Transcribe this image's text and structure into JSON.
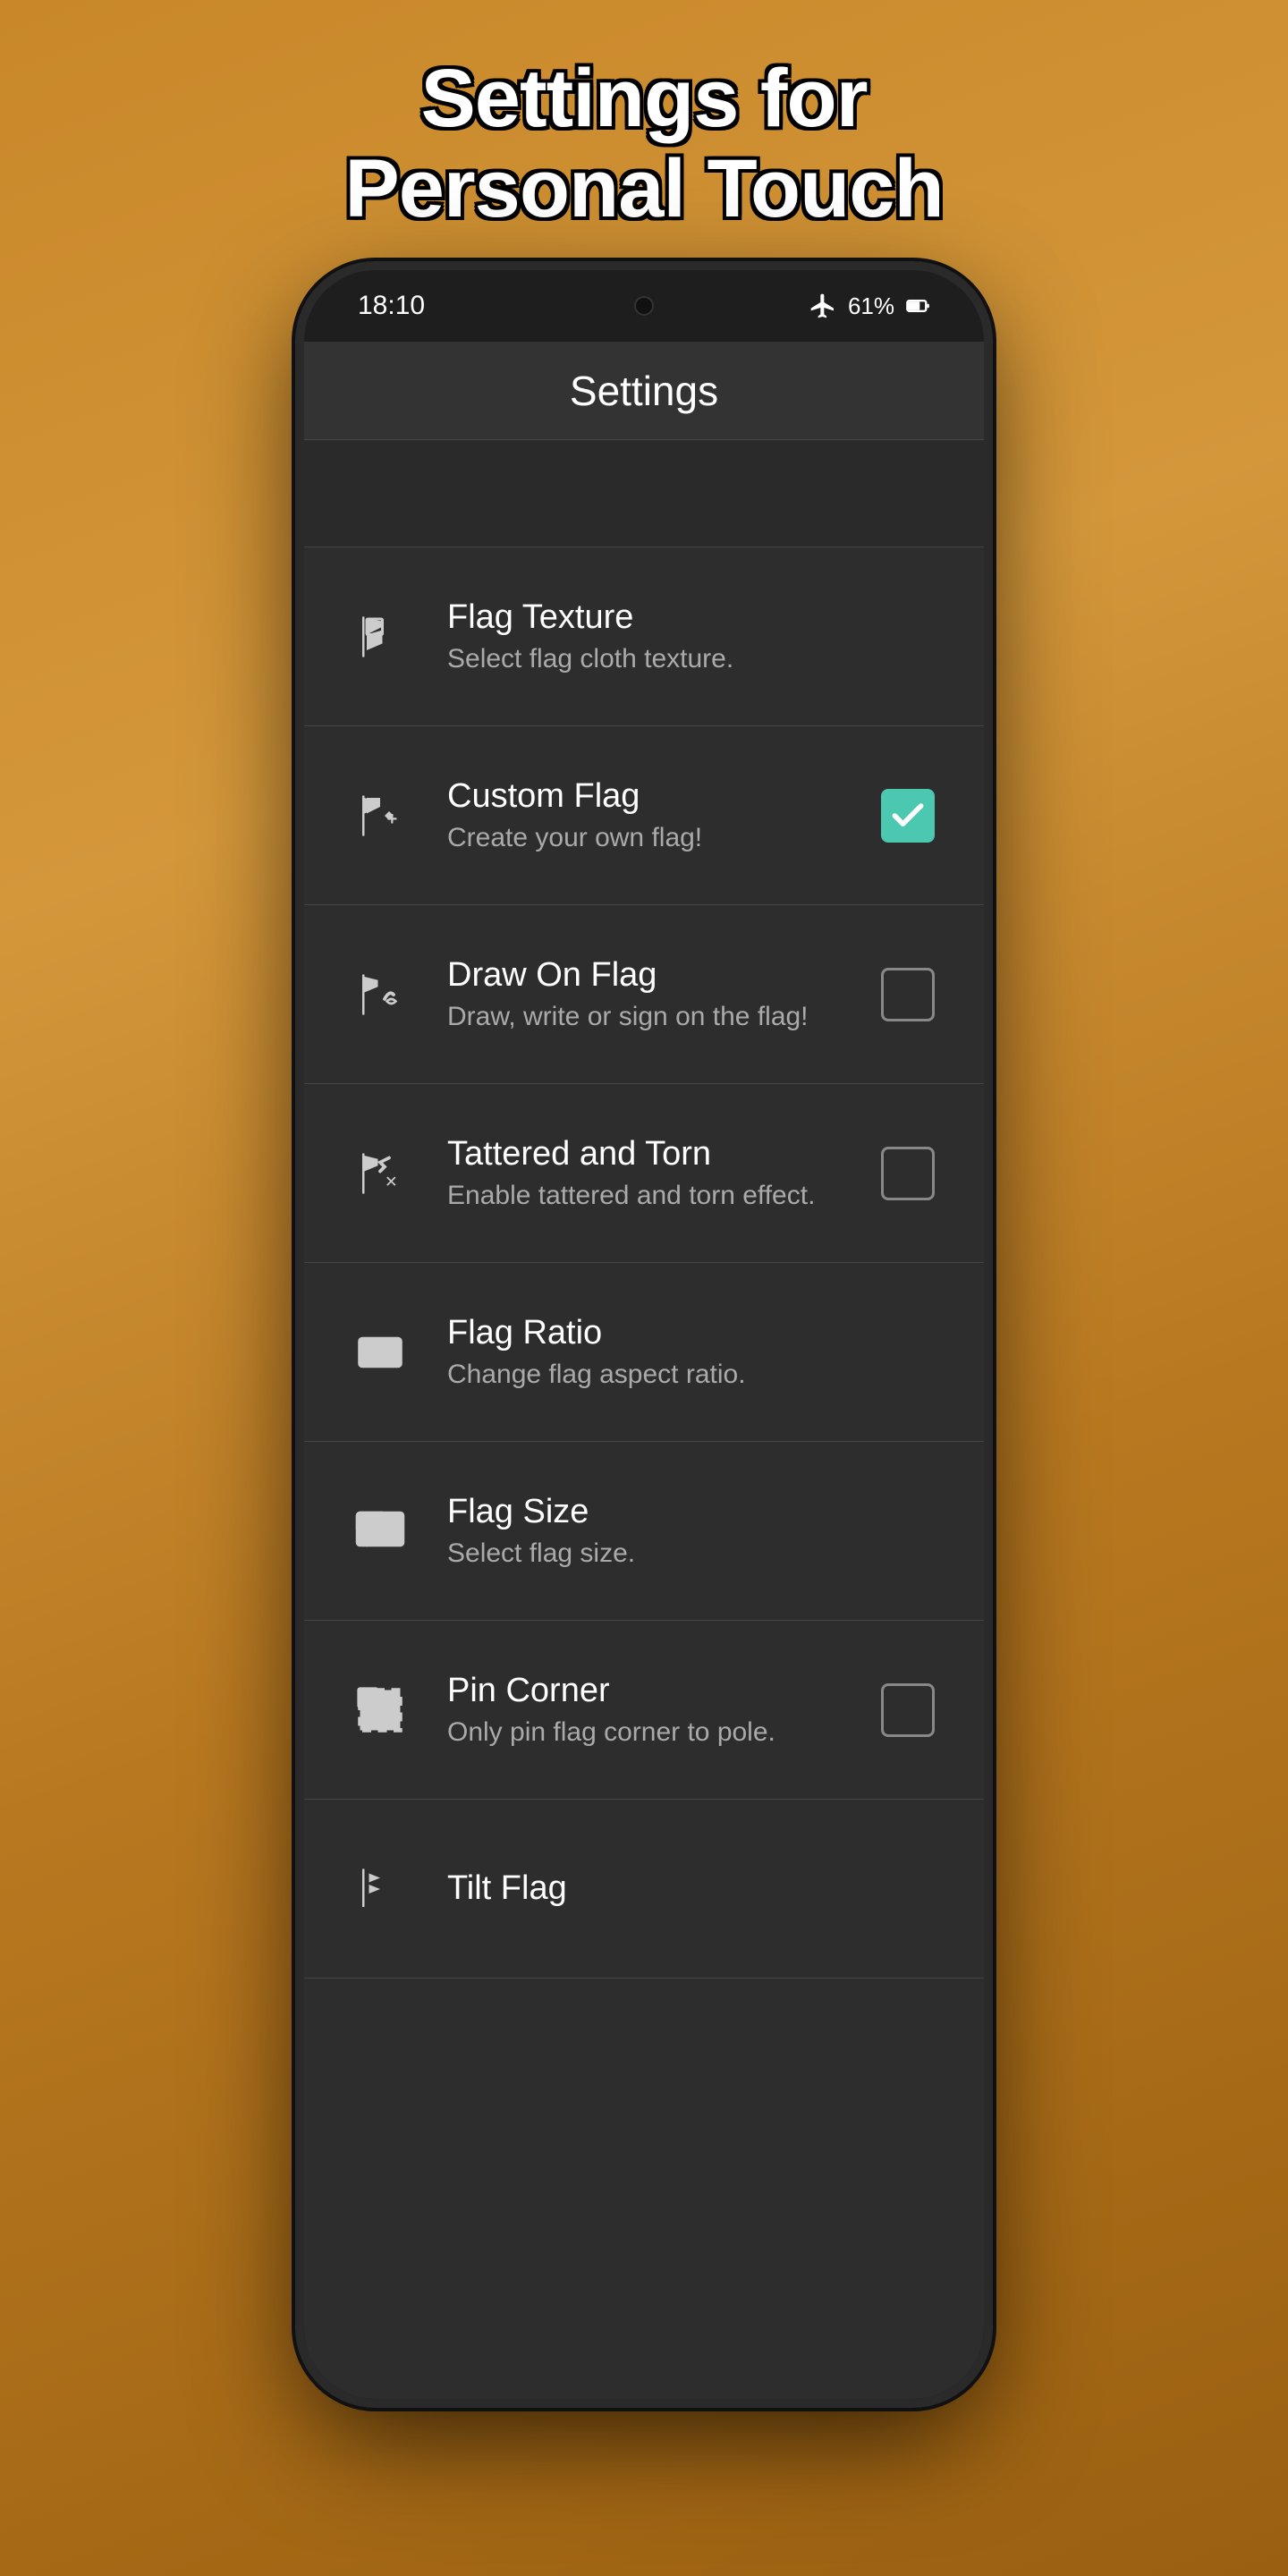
{
  "header": {
    "title_line1": "Settings for",
    "title_line2": "Personal Touch"
  },
  "status_bar": {
    "time": "18:10",
    "battery_percent": "61%",
    "battery_icon": "battery-icon",
    "airplane_icon": "airplane-icon"
  },
  "app_bar": {
    "title": "Settings"
  },
  "settings": {
    "items": [
      {
        "id": "flag-texture",
        "title": "Flag Texture",
        "subtitle": "Select flag cloth texture.",
        "icon": "flag-texture-icon",
        "control": "none"
      },
      {
        "id": "custom-flag",
        "title": "Custom Flag",
        "subtitle": "Create your own flag!",
        "icon": "custom-flag-icon",
        "control": "checkbox-checked"
      },
      {
        "id": "draw-on-flag",
        "title": "Draw On Flag",
        "subtitle": "Draw, write or sign on the flag!",
        "icon": "draw-flag-icon",
        "control": "checkbox-unchecked"
      },
      {
        "id": "tattered-torn",
        "title": "Tattered and Torn",
        "subtitle": "Enable tattered and torn effect.",
        "icon": "tattered-icon",
        "control": "checkbox-unchecked"
      },
      {
        "id": "flag-ratio",
        "title": "Flag Ratio",
        "subtitle": "Change flag aspect ratio.",
        "icon": "flag-ratio-icon",
        "control": "none"
      },
      {
        "id": "flag-size",
        "title": "Flag Size",
        "subtitle": "Select flag size.",
        "icon": "flag-size-icon",
        "control": "none"
      },
      {
        "id": "pin-corner",
        "title": "Pin Corner",
        "subtitle": "Only pin flag corner to pole.",
        "icon": "pin-corner-icon",
        "control": "checkbox-unchecked"
      },
      {
        "id": "tilt-flag",
        "title": "Tilt Flag",
        "subtitle": "",
        "icon": "tilt-flag-icon",
        "control": "none"
      }
    ]
  }
}
